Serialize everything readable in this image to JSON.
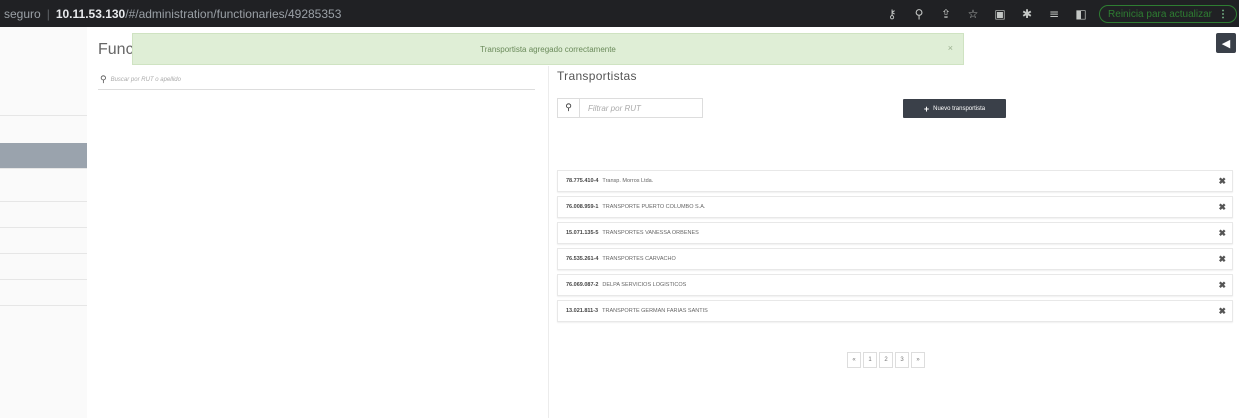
{
  "browser": {
    "security_label": "seguro",
    "url_host": "10.11.53.130",
    "url_path": "/#/administration/functionaries/49285353",
    "update_label": "Reinicia para actualizar",
    "update_menu": "⋮"
  },
  "page": {
    "title": "Func"
  },
  "toast": {
    "message": "Transportista agregado correctamente",
    "close": "×"
  },
  "left_search": {
    "placeholder": "Buscar por RUT o apellido"
  },
  "carriers": {
    "title": "Transportistas",
    "filter_placeholder": "Filtrar por RUT",
    "new_button": "Nuevo transportista",
    "rows": [
      {
        "rut": "78.775.410-4",
        "name": "Transp. Morros Ltda."
      },
      {
        "rut": "76.008.959-1",
        "name": "TRANSPORTE PUERTO COLUMBO S.A."
      },
      {
        "rut": "15.071.135-5",
        "name": "TRANSPORTES VANESSA ORBENES"
      },
      {
        "rut": "76.535.261-4",
        "name": "TRANSPORTES CARVACHO"
      },
      {
        "rut": "76.069.087-2",
        "name": "DELPA SERVICIOS LOGISTICOS"
      },
      {
        "rut": "13.021.811-3",
        "name": "TRANSPORTE GERMAN FARIAS SANTIS"
      }
    ]
  },
  "pagination": {
    "prev": "«",
    "pages": [
      "1",
      "2",
      "3"
    ],
    "next": "»"
  },
  "colors": {
    "toast_bg": "#dfeed6",
    "dark_button": "#3a4049",
    "sidebar_active": "#9aa3ad"
  }
}
